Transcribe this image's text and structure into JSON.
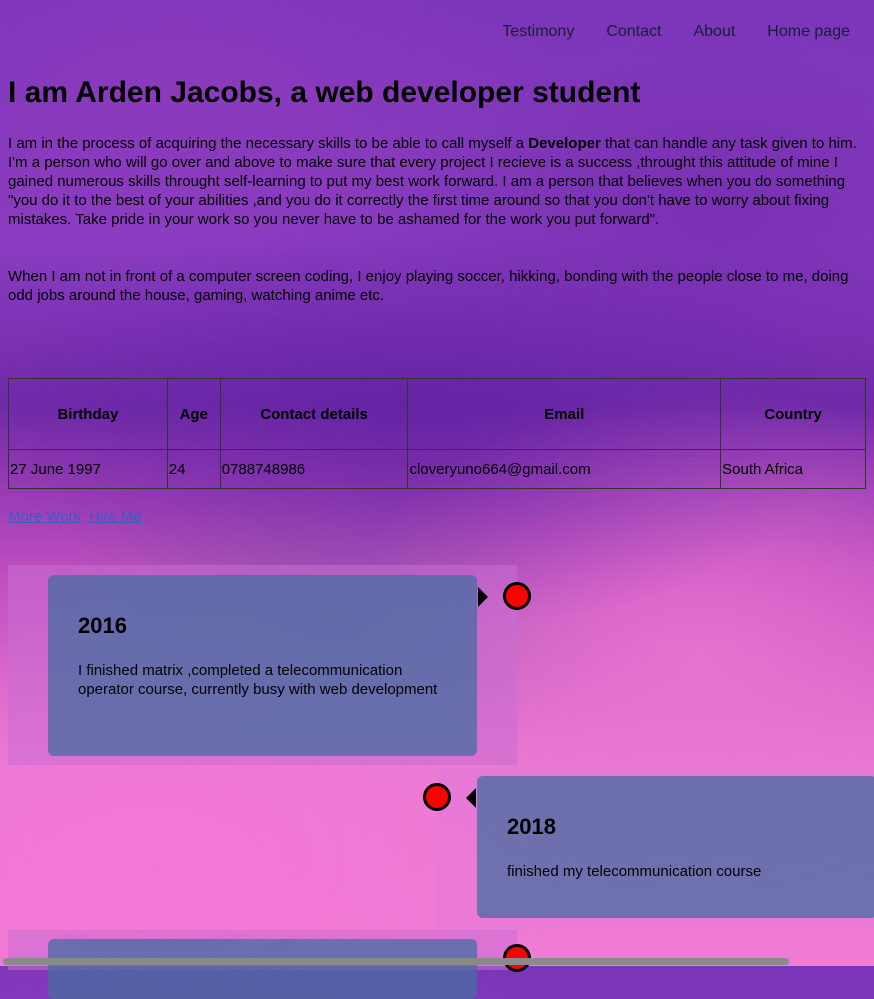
{
  "nav": {
    "items": [
      "Testimony",
      "Contact",
      "About",
      "Home page"
    ]
  },
  "hero": {
    "title": "I am Arden Jacobs, a web developer student",
    "intro_before": "I am in the process of acquiring the necessary skills to be able to call myself a ",
    "intro_bold": "Developer",
    "intro_after": " that can handle any task given to him. I'm a person who will go over and above to make sure that every project I recieve is a success ,throught this attitude of mine I gained numerous skills throught self-learning to put my best work forward. I am a person that believes when you do something \"you do it to the best of your abilities ,and you do it correctly the first time around so that you don't have to worry about fixing mistakes. Take pride in your work so you never have to be ashamed for the work you put forward\".",
    "hobbies": "When I am not in front of a computer screen coding, I enjoy playing soccer, hikking, bonding with the people close to me, doing odd jobs around the house, gaming, watching anime etc."
  },
  "table": {
    "headers": [
      "Birthday",
      "Age",
      "Contact details",
      "Email",
      "Country"
    ],
    "row": [
      "27 June 1997",
      "24",
      "0788748986",
      "cloveryuno664@gmail.com",
      "South Africa"
    ]
  },
  "links": {
    "more_work": "More Work",
    "hire_me": "Hire Me"
  },
  "timeline": [
    {
      "year": "2016",
      "text": "I finished matrix ,completed a telecommunication operator course, currently busy with web development"
    },
    {
      "year": "2018",
      "text": "finished my telecommunication course"
    }
  ],
  "colors": {
    "dot": "#ff0000",
    "card": "#466ea0",
    "link": "#3a5cc0"
  }
}
